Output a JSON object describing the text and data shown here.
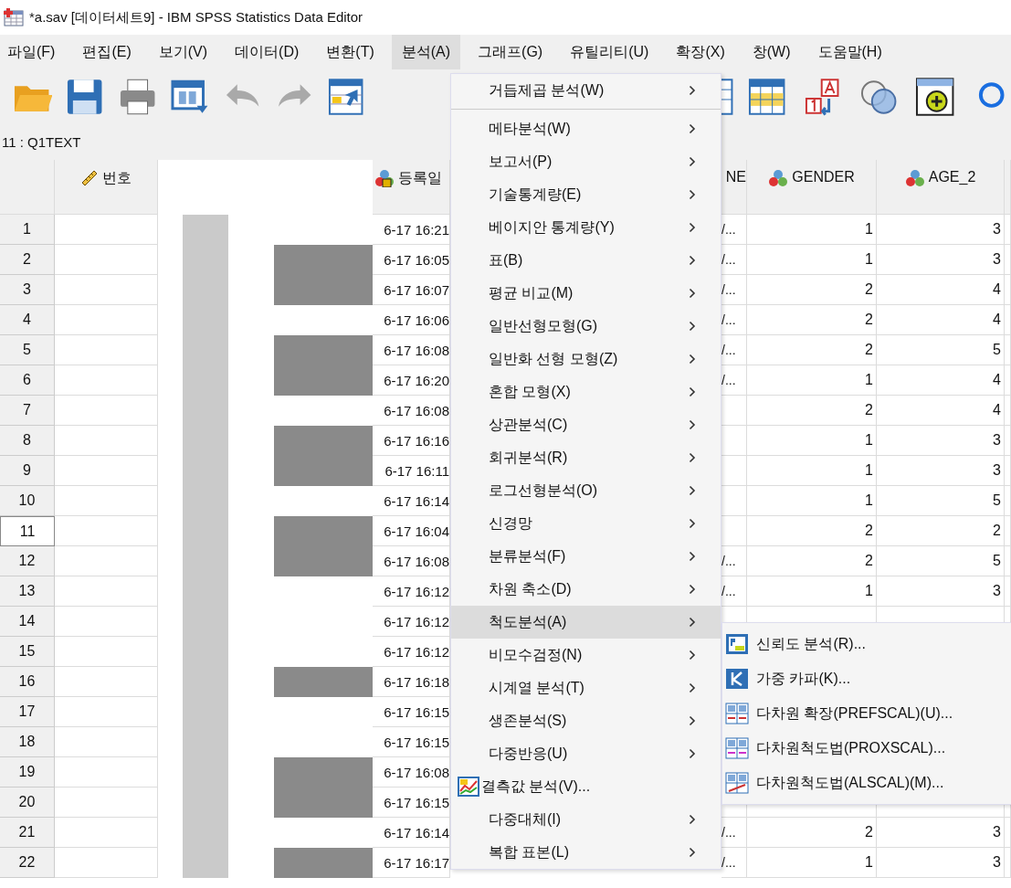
{
  "window": {
    "title": "*a.sav [데이터세트9] - IBM SPSS Statistics Data Editor"
  },
  "menu_bar": [
    {
      "label": "파일(F)",
      "selected": false
    },
    {
      "label": "편집(E)",
      "selected": false
    },
    {
      "label": "보기(V)",
      "selected": false
    },
    {
      "label": "데이터(D)",
      "selected": false
    },
    {
      "label": "변환(T)",
      "selected": false
    },
    {
      "label": "분석(A)",
      "selected": true
    },
    {
      "label": "그래프(G)",
      "selected": false
    },
    {
      "label": "유틸리티(U)",
      "selected": false
    },
    {
      "label": "확장(X)",
      "selected": false
    },
    {
      "label": "창(W)",
      "selected": false
    },
    {
      "label": "도움말(H)",
      "selected": false
    }
  ],
  "toolbar": [
    {
      "kind": "open",
      "disabled": false
    },
    {
      "kind": "save",
      "disabled": false
    },
    {
      "kind": "print",
      "disabled": false
    },
    {
      "kind": "dialog",
      "disabled": false
    },
    {
      "kind": "undo",
      "disabled": true
    },
    {
      "kind": "redo",
      "disabled": true
    },
    {
      "kind": "goto",
      "disabled": false
    },
    {
      "kind": "variables",
      "disabled": false
    },
    {
      "kind": "grid",
      "disabled": false
    },
    {
      "kind": "labels",
      "disabled": false
    },
    {
      "kind": "sets",
      "disabled": false
    },
    {
      "kind": "addon",
      "disabled": false
    },
    {
      "kind": "search",
      "disabled": false
    }
  ],
  "cell_reference": "11 : Q1TEXT",
  "columns": [
    {
      "label": "번호",
      "kind": "scale"
    },
    {
      "label": "등록일",
      "kind": "string"
    },
    {
      "label": "NE"
    },
    {
      "label": "GENDER",
      "kind": "nominal"
    },
    {
      "label": "AGE_2",
      "kind": "nominal"
    }
  ],
  "rows": [
    {
      "number": "1",
      "selected": false,
      "masked": false,
      "date": "6-17 16:21",
      "ne": "/...",
      "gender": "1",
      "age": "3"
    },
    {
      "number": "2",
      "selected": false,
      "masked": true,
      "date": "6-17 16:05",
      "ne": "/...",
      "gender": "1",
      "age": "3"
    },
    {
      "number": "3",
      "selected": false,
      "masked": true,
      "date": "6-17 16:07",
      "ne": "/...",
      "gender": "2",
      "age": "4"
    },
    {
      "number": "4",
      "selected": false,
      "masked": false,
      "date": "6-17 16:06",
      "ne": "/...",
      "gender": "2",
      "age": "4"
    },
    {
      "number": "5",
      "selected": false,
      "masked": true,
      "date": "6-17 16:08",
      "ne": "/...",
      "gender": "2",
      "age": "5"
    },
    {
      "number": "6",
      "selected": false,
      "masked": true,
      "date": "6-17 16:20",
      "ne": "/...",
      "gender": "1",
      "age": "4"
    },
    {
      "number": "7",
      "selected": false,
      "masked": false,
      "date": "6-17 16:08",
      "gender": "2",
      "age": "4"
    },
    {
      "number": "8",
      "selected": false,
      "masked": true,
      "date": "6-17 16:16",
      "gender": "1",
      "age": "3"
    },
    {
      "number": "9",
      "selected": false,
      "masked": true,
      "date": "6-17 16:11",
      "gender": "1",
      "age": "3"
    },
    {
      "number": "10",
      "selected": false,
      "masked": false,
      "date": "6-17 16:14",
      "gender": "1",
      "age": "5"
    },
    {
      "number": "11",
      "selected": true,
      "masked": true,
      "date": "6-17 16:04",
      "gender": "2",
      "age": "2"
    },
    {
      "number": "12",
      "selected": false,
      "masked": true,
      "date": "6-17 16:08",
      "ne": "/...",
      "gender": "2",
      "age": "5"
    },
    {
      "number": "13",
      "selected": false,
      "masked": false,
      "date": "6-17 16:12",
      "ne": "/...",
      "gender": "1",
      "age": "3"
    },
    {
      "number": "14",
      "selected": false,
      "masked": false,
      "date": "6-17 16:12"
    },
    {
      "number": "15",
      "selected": false,
      "masked": false,
      "date": "6-17 16:12"
    },
    {
      "number": "16",
      "selected": false,
      "masked": true,
      "date": "6-17 16:18"
    },
    {
      "number": "17",
      "selected": false,
      "masked": false,
      "date": "6-17 16:15"
    },
    {
      "number": "18",
      "selected": false,
      "masked": false,
      "date": "6-17 16:15"
    },
    {
      "number": "19",
      "selected": false,
      "masked": true,
      "date": "6-17 16:08"
    },
    {
      "number": "20",
      "selected": false,
      "masked": true,
      "date": "6-17 16:15"
    },
    {
      "number": "21",
      "selected": false,
      "masked": false,
      "date": "6-17 16:14",
      "ne": "/...",
      "gender": "2",
      "age": "3"
    },
    {
      "number": "22",
      "selected": false,
      "masked": true,
      "date": "6-17 16:17",
      "ne": "/...",
      "gender": "1",
      "age": "3"
    }
  ],
  "analyze_menu": [
    {
      "label": "거듭제곱 분석(W)",
      "kind": "submenu",
      "selected": false,
      "separator_after": true
    },
    {
      "label": "메타분석(W)",
      "kind": "submenu",
      "selected": false
    },
    {
      "label": "보고서(P)",
      "kind": "submenu",
      "selected": false
    },
    {
      "label": "기술통계량(E)",
      "kind": "submenu",
      "selected": false
    },
    {
      "label": "베이지안 통계량(Y)",
      "kind": "submenu",
      "selected": false
    },
    {
      "label": "표(B)",
      "kind": "submenu",
      "selected": false
    },
    {
      "label": "평균 비교(M)",
      "kind": "submenu",
      "selected": false
    },
    {
      "label": "일반선형모형(G)",
      "kind": "submenu",
      "selected": false
    },
    {
      "label": "일반화 선형 모형(Z)",
      "kind": "submenu",
      "selected": false
    },
    {
      "label": "혼합 모형(X)",
      "kind": "submenu",
      "selected": false
    },
    {
      "label": "상관분석(C)",
      "kind": "submenu",
      "selected": false
    },
    {
      "label": "회귀분석(R)",
      "kind": "submenu",
      "selected": false
    },
    {
      "label": "로그선형분석(O)",
      "kind": "submenu",
      "selected": false
    },
    {
      "label": "신경망",
      "kind": "submenu",
      "selected": false
    },
    {
      "label": "분류분석(F)",
      "kind": "submenu",
      "selected": false
    },
    {
      "label": "차원 축소(D)",
      "kind": "submenu",
      "selected": false
    },
    {
      "label": "척도분석(A)",
      "kind": "submenu",
      "selected": true
    },
    {
      "label": "비모수검정(N)",
      "kind": "submenu",
      "selected": false
    },
    {
      "label": "시계열 분석(T)",
      "kind": "submenu",
      "selected": false
    },
    {
      "label": "생존분석(S)",
      "kind": "submenu",
      "selected": false
    },
    {
      "label": "다중반응(U)",
      "kind": "submenu",
      "selected": false
    },
    {
      "label": "결측값 분석(V)...",
      "kind": "action",
      "selected": false
    },
    {
      "label": "다중대체(I)",
      "kind": "submenu",
      "selected": false
    },
    {
      "label": "복합 표본(L)",
      "kind": "submenu",
      "selected": false
    }
  ],
  "scale_submenu": [
    {
      "label": "신뢰도 분석(R)...",
      "kind": "reliability"
    },
    {
      "label": "가중 카파(K)...",
      "kind": "kappa"
    },
    {
      "label": "다차원 확장(PREFSCAL)(U)...",
      "kind": "prefscal"
    },
    {
      "label": "다차원척도법(PROXSCAL)...",
      "kind": "proxscal"
    },
    {
      "label": "다차원척도법(ALSCAL)(M)...",
      "kind": "alscal"
    }
  ]
}
